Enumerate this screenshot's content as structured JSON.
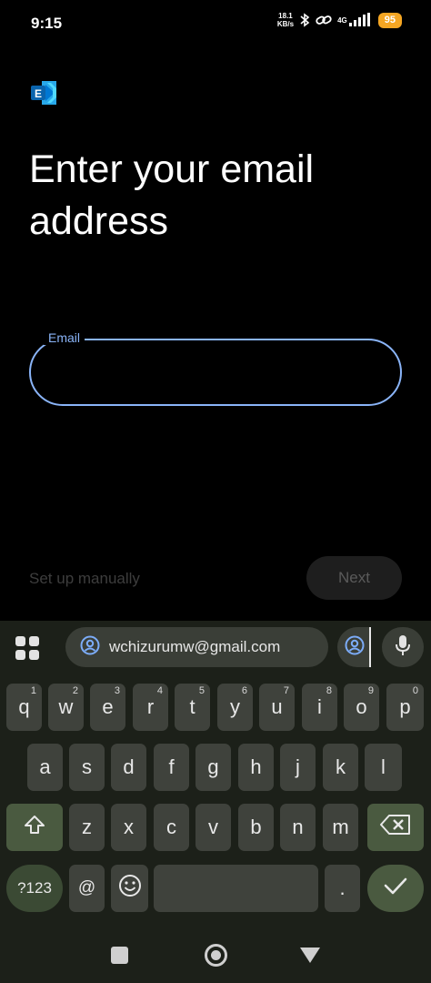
{
  "status_bar": {
    "time": "9:15",
    "net_speed_value": "18.1",
    "net_speed_unit": "KB/s",
    "network_type": "4G",
    "battery": "95"
  },
  "app": {
    "title": "Enter your email address",
    "email_label": "Email",
    "email_value": "",
    "setup_manually": "Set up manually",
    "next": "Next"
  },
  "keyboard": {
    "suggestion": "wchizurumw@gmail.com",
    "row1": [
      {
        "key": "q",
        "hint": "1"
      },
      {
        "key": "w",
        "hint": "2"
      },
      {
        "key": "e",
        "hint": "3"
      },
      {
        "key": "r",
        "hint": "4"
      },
      {
        "key": "t",
        "hint": "5"
      },
      {
        "key": "y",
        "hint": "6"
      },
      {
        "key": "u",
        "hint": "7"
      },
      {
        "key": "i",
        "hint": "8"
      },
      {
        "key": "o",
        "hint": "9"
      },
      {
        "key": "p",
        "hint": "0"
      }
    ],
    "row2": [
      "a",
      "s",
      "d",
      "f",
      "g",
      "h",
      "j",
      "k",
      "l"
    ],
    "row3": [
      "z",
      "x",
      "c",
      "v",
      "b",
      "n",
      "m"
    ],
    "symbols_key": "?123",
    "at_key": "@",
    "period_key": "."
  },
  "colors": {
    "accent": "#8ab4f8",
    "keyboard_bg": "#1c2019",
    "key_bg": "#3f423c",
    "modifier_key_bg": "#4a5a40",
    "battery": "#f5a623"
  }
}
